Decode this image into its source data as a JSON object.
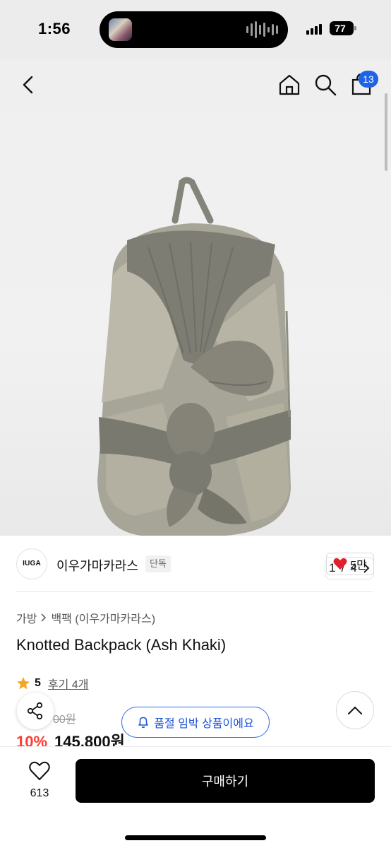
{
  "status_bar": {
    "time": "1:56",
    "battery": "77"
  },
  "nav": {
    "back_icon": "chevron-left-icon",
    "home_icon": "home-icon",
    "search_icon": "search-icon",
    "cart_icon": "shopping-bag-icon",
    "cart_count": "13"
  },
  "gallery": {
    "current": "1",
    "separator": "/",
    "total": "4"
  },
  "brand": {
    "logo_text": "IUGA",
    "name": "이우가마카라스",
    "tag": "단독",
    "likes": "5만"
  },
  "breadcrumb": {
    "category": "가방",
    "subcategory": "백팩 (이우가마카라스)"
  },
  "product": {
    "title": "Knotted Backpack (Ash Khaki)",
    "rating": "5",
    "reviews": "후기 4개",
    "original_price": "00원",
    "discount": "10%",
    "price": "145,800원"
  },
  "notice": {
    "stock_text": "품절 임박 상품이에요"
  },
  "bottom": {
    "wish_count": "613",
    "buy_label": "구매하기"
  },
  "colors": {
    "accent_blue": "#1f63e6",
    "discount_red": "#ff3b30",
    "heart_red": "#e0202b",
    "star": "#f5a623",
    "buy_button": "#000000"
  }
}
